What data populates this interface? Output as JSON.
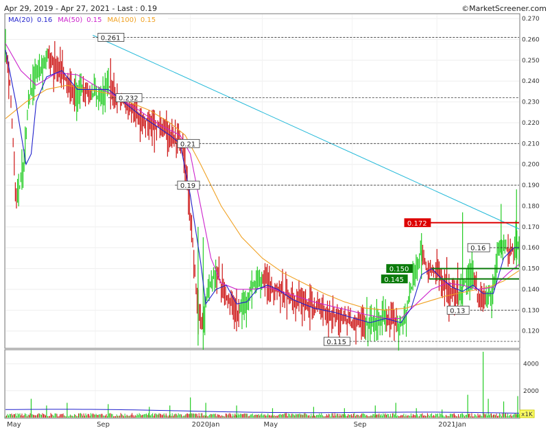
{
  "header": {
    "range_text": "Apr 29, 2019 - Apr 27, 2021 - Last : 0.19",
    "source": "©MarketScreener.com"
  },
  "colors": {
    "ma20": "#1f1fcc",
    "ma50": "#cc22cc",
    "ma100": "#f0a020",
    "trend": "#20b8d8",
    "up": "#22cc22",
    "down": "#cc1111",
    "red_level": "#dd0000",
    "green_level": "#0a7a0a"
  },
  "chart_data": {
    "type": "candlestick",
    "legend": [
      {
        "label": "MA(20)",
        "value": "0.16",
        "color": "#1f1fcc"
      },
      {
        "label": "MA(50)",
        "value": "0.15",
        "color": "#cc22cc"
      },
      {
        "label": "MA(100)",
        "value": "0.15",
        "color": "#f0a020"
      }
    ],
    "x_labels": [
      "May",
      "Sep",
      "2020Jan",
      "May",
      "Sep",
      "2021Jan"
    ],
    "y_ticks": [
      "0.120",
      "0.130",
      "0.140",
      "0.150",
      "0.160",
      "0.170",
      "0.180",
      "0.190",
      "0.200",
      "0.210",
      "0.220",
      "0.230",
      "0.240",
      "0.250",
      "0.260",
      "0.270"
    ],
    "ylim": [
      0.112,
      0.272
    ],
    "volume_ticks": [
      "2000",
      "4000"
    ],
    "volume_unit": "x1K",
    "horizontal_levels": [
      {
        "value": 0.261,
        "label": "0.261",
        "style": "dashed"
      },
      {
        "value": 0.232,
        "label": "0.232",
        "style": "dashed"
      },
      {
        "value": 0.21,
        "label": "0.21",
        "style": "dashed"
      },
      {
        "value": 0.19,
        "label": "0.19",
        "style": "dashed"
      },
      {
        "value": 0.16,
        "label": "0.16",
        "style": "dashed"
      },
      {
        "value": 0.13,
        "label": "0.13",
        "style": "dashed"
      },
      {
        "value": 0.115,
        "label": "0.115",
        "style": "dashed"
      },
      {
        "value": 0.172,
        "label": "0.172",
        "style": "red"
      },
      {
        "value": 0.15,
        "label": "0.150",
        "style": "green"
      },
      {
        "value": 0.145,
        "label": "0.145",
        "style": "green"
      }
    ],
    "trendline": {
      "from": [
        0.17,
        0.262
      ],
      "to": [
        1.0,
        0.169
      ]
    },
    "price_path": [
      [
        0.0,
        0.258
      ],
      [
        0.01,
        0.235
      ],
      [
        0.02,
        0.183
      ],
      [
        0.035,
        0.196
      ],
      [
        0.045,
        0.232
      ],
      [
        0.06,
        0.243
      ],
      [
        0.08,
        0.252
      ],
      [
        0.1,
        0.247
      ],
      [
        0.12,
        0.24
      ],
      [
        0.135,
        0.233
      ],
      [
        0.15,
        0.238
      ],
      [
        0.165,
        0.233
      ],
      [
        0.18,
        0.233
      ],
      [
        0.2,
        0.238
      ],
      [
        0.22,
        0.232
      ],
      [
        0.24,
        0.227
      ],
      [
        0.26,
        0.223
      ],
      [
        0.28,
        0.22
      ],
      [
        0.3,
        0.218
      ],
      [
        0.315,
        0.215
      ],
      [
        0.33,
        0.212
      ],
      [
        0.345,
        0.208
      ],
      [
        0.355,
        0.19
      ],
      [
        0.365,
        0.16
      ],
      [
        0.375,
        0.13
      ],
      [
        0.385,
        0.125
      ],
      [
        0.395,
        0.14
      ],
      [
        0.41,
        0.148
      ],
      [
        0.425,
        0.14
      ],
      [
        0.44,
        0.132
      ],
      [
        0.455,
        0.128
      ],
      [
        0.47,
        0.135
      ],
      [
        0.485,
        0.143
      ],
      [
        0.5,
        0.145
      ],
      [
        0.52,
        0.141
      ],
      [
        0.54,
        0.138
      ],
      [
        0.56,
        0.135
      ],
      [
        0.58,
        0.134
      ],
      [
        0.6,
        0.132
      ],
      [
        0.62,
        0.13
      ],
      [
        0.64,
        0.128
      ],
      [
        0.66,
        0.126
      ],
      [
        0.68,
        0.124
      ],
      [
        0.7,
        0.123
      ],
      [
        0.72,
        0.124
      ],
      [
        0.74,
        0.126
      ],
      [
        0.76,
        0.123
      ],
      [
        0.775,
        0.124
      ],
      [
        0.79,
        0.14
      ],
      [
        0.8,
        0.152
      ],
      [
        0.81,
        0.158
      ],
      [
        0.82,
        0.15
      ],
      [
        0.835,
        0.148
      ],
      [
        0.85,
        0.145
      ],
      [
        0.865,
        0.139
      ],
      [
        0.88,
        0.136
      ],
      [
        0.895,
        0.143
      ],
      [
        0.91,
        0.148
      ],
      [
        0.92,
        0.136
      ],
      [
        0.935,
        0.135
      ],
      [
        0.95,
        0.14
      ],
      [
        0.96,
        0.16
      ],
      [
        0.975,
        0.16
      ],
      [
        0.99,
        0.158
      ],
      [
        1.0,
        0.16
      ]
    ],
    "ma20_path": [
      [
        0.0,
        0.255
      ],
      [
        0.02,
        0.23
      ],
      [
        0.04,
        0.2
      ],
      [
        0.05,
        0.205
      ],
      [
        0.06,
        0.23
      ],
      [
        0.08,
        0.242
      ],
      [
        0.11,
        0.245
      ],
      [
        0.14,
        0.236
      ],
      [
        0.17,
        0.236
      ],
      [
        0.2,
        0.236
      ],
      [
        0.23,
        0.23
      ],
      [
        0.26,
        0.224
      ],
      [
        0.29,
        0.219
      ],
      [
        0.32,
        0.214
      ],
      [
        0.34,
        0.21
      ],
      [
        0.36,
        0.185
      ],
      [
        0.38,
        0.153
      ],
      [
        0.39,
        0.133
      ],
      [
        0.41,
        0.14
      ],
      [
        0.43,
        0.142
      ],
      [
        0.45,
        0.133
      ],
      [
        0.47,
        0.134
      ],
      [
        0.49,
        0.14
      ],
      [
        0.51,
        0.142
      ],
      [
        0.53,
        0.14
      ],
      [
        0.56,
        0.135
      ],
      [
        0.6,
        0.131
      ],
      [
        0.64,
        0.129
      ],
      [
        0.68,
        0.126
      ],
      [
        0.71,
        0.124
      ],
      [
        0.74,
        0.126
      ],
      [
        0.77,
        0.124
      ],
      [
        0.79,
        0.131
      ],
      [
        0.81,
        0.147
      ],
      [
        0.83,
        0.15
      ],
      [
        0.85,
        0.145
      ],
      [
        0.87,
        0.141
      ],
      [
        0.89,
        0.139
      ],
      [
        0.91,
        0.142
      ],
      [
        0.93,
        0.138
      ],
      [
        0.95,
        0.138
      ],
      [
        0.97,
        0.155
      ],
      [
        0.99,
        0.16
      ],
      [
        1.0,
        0.16
      ]
    ],
    "ma50_path": [
      [
        0.0,
        0.258
      ],
      [
        0.03,
        0.245
      ],
      [
        0.06,
        0.238
      ],
      [
        0.1,
        0.244
      ],
      [
        0.14,
        0.243
      ],
      [
        0.18,
        0.237
      ],
      [
        0.22,
        0.232
      ],
      [
        0.26,
        0.226
      ],
      [
        0.3,
        0.219
      ],
      [
        0.34,
        0.214
      ],
      [
        0.36,
        0.205
      ],
      [
        0.38,
        0.18
      ],
      [
        0.4,
        0.155
      ],
      [
        0.42,
        0.143
      ],
      [
        0.45,
        0.14
      ],
      [
        0.48,
        0.14
      ],
      [
        0.51,
        0.141
      ],
      [
        0.55,
        0.138
      ],
      [
        0.6,
        0.134
      ],
      [
        0.65,
        0.131
      ],
      [
        0.7,
        0.128
      ],
      [
        0.74,
        0.126
      ],
      [
        0.77,
        0.126
      ],
      [
        0.8,
        0.133
      ],
      [
        0.83,
        0.14
      ],
      [
        0.86,
        0.143
      ],
      [
        0.89,
        0.142
      ],
      [
        0.92,
        0.14
      ],
      [
        0.95,
        0.141
      ],
      [
        0.98,
        0.148
      ],
      [
        1.0,
        0.152
      ]
    ],
    "ma100_path": [
      [
        0.0,
        0.222
      ],
      [
        0.04,
        0.23
      ],
      [
        0.08,
        0.236
      ],
      [
        0.12,
        0.238
      ],
      [
        0.16,
        0.236
      ],
      [
        0.2,
        0.234
      ],
      [
        0.24,
        0.23
      ],
      [
        0.28,
        0.226
      ],
      [
        0.32,
        0.22
      ],
      [
        0.35,
        0.214
      ],
      [
        0.38,
        0.2
      ],
      [
        0.42,
        0.18
      ],
      [
        0.46,
        0.165
      ],
      [
        0.5,
        0.155
      ],
      [
        0.54,
        0.148
      ],
      [
        0.58,
        0.143
      ],
      [
        0.62,
        0.138
      ],
      [
        0.66,
        0.134
      ],
      [
        0.7,
        0.131
      ],
      [
        0.74,
        0.13
      ],
      [
        0.78,
        0.131
      ],
      [
        0.82,
        0.134
      ],
      [
        0.86,
        0.137
      ],
      [
        0.9,
        0.139
      ],
      [
        0.94,
        0.141
      ],
      [
        0.97,
        0.144
      ],
      [
        1.0,
        0.149
      ]
    ],
    "volume_spikes": [
      [
        0.05,
        1400
      ],
      [
        0.08,
        900
      ],
      [
        0.12,
        1100
      ],
      [
        0.2,
        1000
      ],
      [
        0.28,
        800
      ],
      [
        0.32,
        900
      ],
      [
        0.36,
        1500
      ],
      [
        0.39,
        1100
      ],
      [
        0.45,
        900
      ],
      [
        0.52,
        700
      ],
      [
        0.6,
        800
      ],
      [
        0.66,
        700
      ],
      [
        0.72,
        900
      ],
      [
        0.76,
        1100
      ],
      [
        0.8,
        700
      ],
      [
        0.85,
        600
      ],
      [
        0.9,
        1700
      ],
      [
        0.93,
        4900
      ],
      [
        0.94,
        1400
      ],
      [
        0.97,
        1200
      ],
      [
        1.0,
        1600
      ]
    ]
  }
}
